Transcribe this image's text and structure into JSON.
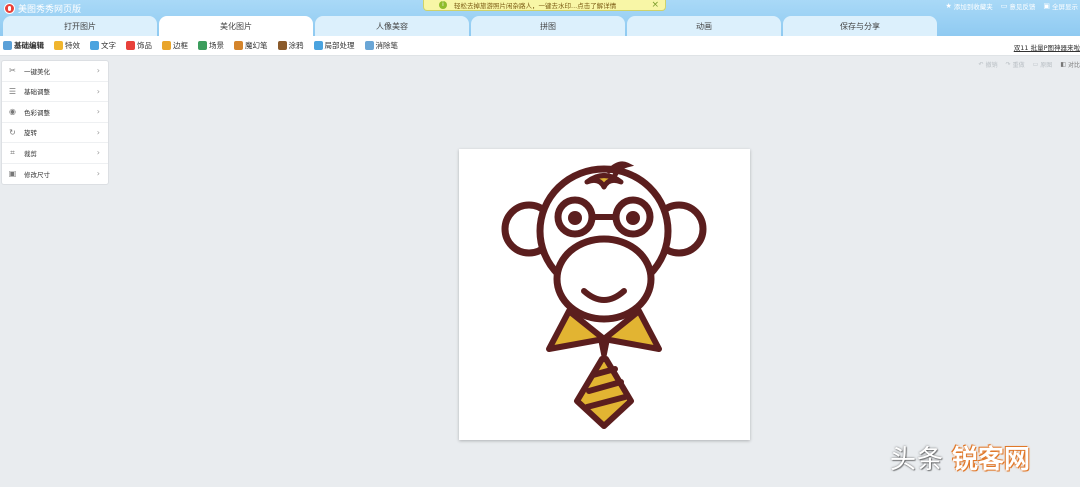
{
  "app": {
    "title": "美图秀秀网页版"
  },
  "notice": {
    "text": "轻松去掉旅游照片闲杂路人，一键去水印...点击了解详情",
    "close": "×"
  },
  "top_links": [
    {
      "label": "添加到收藏夹",
      "icon": "star-icon"
    },
    {
      "label": "意见反馈",
      "icon": "feedback-icon"
    },
    {
      "label": "全屏显示",
      "icon": "fullscreen-icon"
    }
  ],
  "tabs": [
    {
      "label": "打开图片"
    },
    {
      "label": "美化图片",
      "active": true
    },
    {
      "label": "人像美容"
    },
    {
      "label": "拼图"
    },
    {
      "label": "动画"
    },
    {
      "label": "保存与分享"
    }
  ],
  "tools": [
    {
      "label": "基础编辑",
      "icon": "edit-icon",
      "color": "#5aa0d8"
    },
    {
      "label": "特效",
      "icon": "wand-icon",
      "color": "#f0b52e"
    },
    {
      "label": "文字",
      "icon": "text-icon",
      "color": "#4aa3df"
    },
    {
      "label": "饰品",
      "icon": "bow-icon",
      "color": "#e8413a"
    },
    {
      "label": "边框",
      "icon": "frame-icon",
      "color": "#e9a52b"
    },
    {
      "label": "场景",
      "icon": "scene-icon",
      "color": "#3c9d5d"
    },
    {
      "label": "魔幻笔",
      "icon": "magic-pen-icon",
      "color": "#d4842b"
    },
    {
      "label": "涂鸦",
      "icon": "brush-icon",
      "color": "#8a5a2b"
    },
    {
      "label": "局部处理",
      "icon": "partial-icon",
      "color": "#4aa3df"
    },
    {
      "label": "消除笔",
      "icon": "eraser-icon",
      "color": "#6aa6d6"
    }
  ],
  "toolbar_right": "双11 批量P图神器来啦",
  "history": [
    {
      "label": "撤销",
      "icon": "undo-icon"
    },
    {
      "label": "重做",
      "icon": "redo-icon"
    },
    {
      "label": "原图",
      "icon": "original-icon"
    },
    {
      "label": "对比",
      "icon": "compare-icon"
    }
  ],
  "panel": [
    {
      "label": "一键美化",
      "icon": "wand-icon",
      "glyph": "✂"
    },
    {
      "label": "基础调整",
      "icon": "sliders-icon",
      "glyph": "☰"
    },
    {
      "label": "色彩调整",
      "icon": "palette-icon",
      "glyph": "◉"
    },
    {
      "label": "旋转",
      "icon": "rotate-icon",
      "glyph": "↻"
    },
    {
      "label": "裁剪",
      "icon": "crop-icon",
      "glyph": "⌗"
    },
    {
      "label": "修改尺寸",
      "icon": "resize-icon",
      "glyph": "▣"
    }
  ],
  "watermark": {
    "part1": "头条",
    "part2": "锐客网"
  },
  "colors": {
    "top_bar": "#8fcaf1",
    "monkey_brown": "#5b1e1e",
    "tie_gold": "#e2b432"
  }
}
